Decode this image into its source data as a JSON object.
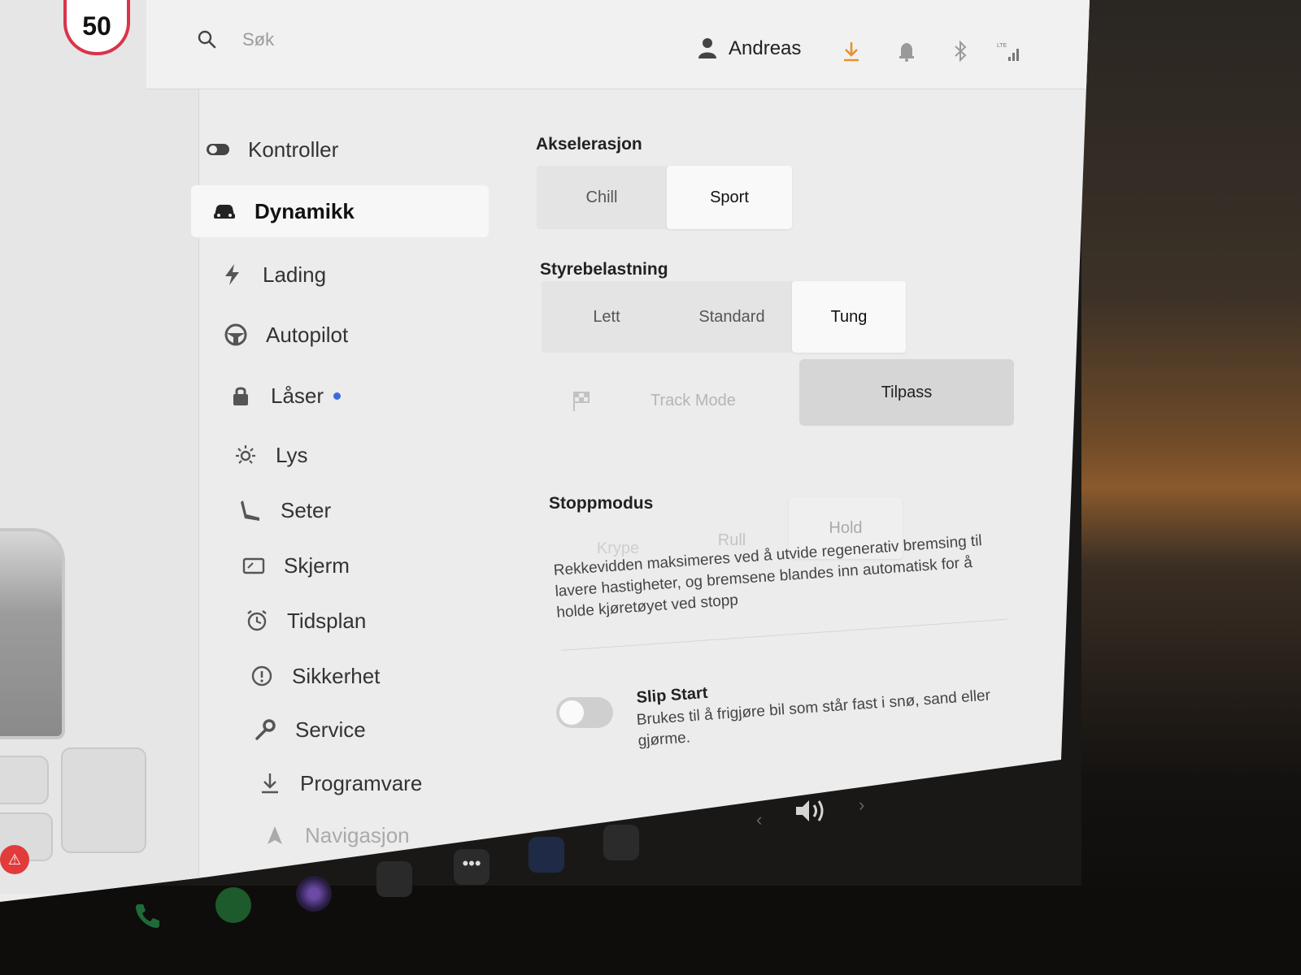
{
  "speed_limit": "50",
  "search": {
    "placeholder": "Søk"
  },
  "user": {
    "name": "Andreas"
  },
  "status": {
    "network": "LTE"
  },
  "nav": {
    "items": [
      {
        "label": "Kontroller",
        "icon": "toggle-icon"
      },
      {
        "label": "Dynamikk",
        "icon": "car-icon",
        "active": true
      },
      {
        "label": "Lading",
        "icon": "lightning-icon"
      },
      {
        "label": "Autopilot",
        "icon": "steering-wheel-icon"
      },
      {
        "label": "Låser",
        "icon": "lock-icon",
        "badge": true
      },
      {
        "label": "Lys",
        "icon": "sun-icon"
      },
      {
        "label": "Seter",
        "icon": "seat-icon"
      },
      {
        "label": "Skjerm",
        "icon": "display-icon"
      },
      {
        "label": "Tidsplan",
        "icon": "alarm-clock-icon"
      },
      {
        "label": "Sikkerhet",
        "icon": "warning-circle-icon"
      },
      {
        "label": "Service",
        "icon": "wrench-icon"
      },
      {
        "label": "Programvare",
        "icon": "download-icon"
      },
      {
        "label": "Navigasjon",
        "icon": "navigation-arrow-icon"
      }
    ]
  },
  "acceleration": {
    "title": "Akselerasjon",
    "options": [
      "Chill",
      "Sport"
    ],
    "selected": "Sport"
  },
  "steering": {
    "title": "Styrebelastning",
    "options": [
      "Lett",
      "Standard",
      "Tung"
    ],
    "selected": "Tung"
  },
  "modes": {
    "track_mode": "Track Mode",
    "custom": "Tilpass"
  },
  "stopping": {
    "title": "Stoppmodus",
    "options": [
      "Krype",
      "Rull",
      "Hold"
    ],
    "selected": "Hold",
    "description": "Rekkevidden maksimeres ved å utvide regenerativ bremsing til lavere hastigheter, og bremsene blandes inn automatisk for å holde kjøretøyet ved stopp"
  },
  "slip_start": {
    "title": "Slip Start",
    "description": "Brukes til å frigjøre bil som står fast i snø, sand eller gjørme.",
    "enabled": false
  },
  "colors": {
    "accent_orange": "#e8912d",
    "speed_ring": "#d9344a",
    "badge_blue": "#3e6ae1"
  }
}
